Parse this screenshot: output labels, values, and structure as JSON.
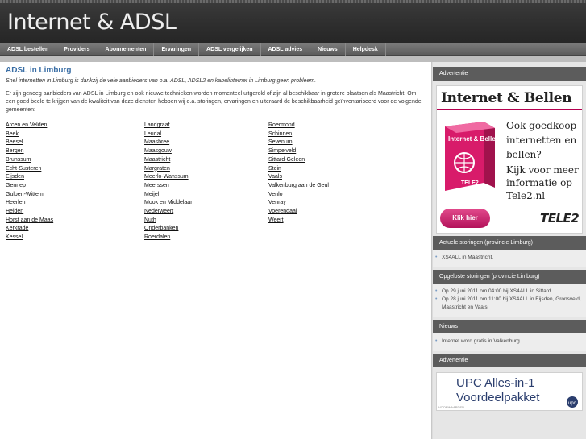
{
  "header": {
    "title": "Internet & ADSL"
  },
  "nav": {
    "items": [
      {
        "label": "ADSL bestellen"
      },
      {
        "label": "Providers"
      },
      {
        "label": "Abonnementen"
      },
      {
        "label": "Ervaringen"
      },
      {
        "label": "ADSL vergelijken"
      },
      {
        "label": "ADSL advies"
      },
      {
        "label": "Nieuws"
      },
      {
        "label": "Helpdesk"
      }
    ]
  },
  "main": {
    "title": "ADSL in Limburg",
    "intro": "Snel internetten in Limburg is dankzij de vele aanbieders van o.a. ADSL, ADSL2 en kabelinternet in Limburg geen probleem.",
    "body": "Er zijn genoeg aanbieders van ADSL in Limburg en ook nieuwe technieken worden momenteel uitgerold of zijn al beschikbaar in grotere plaatsen als Maastricht. Om een goed beeld te krijgen van de kwaliteit van deze diensten hebben wij o.a. storingen, ervaringen en uiteraard de beschikbaarheid geïnventariseerd voor de volgende gemeenten:",
    "col1": [
      "Arcen en Velden",
      "Beek",
      "Beesel",
      "Bergen",
      "Brunssum",
      "Echt-Susteren",
      "Eijsden",
      "Gennep",
      "Gulpen-Wittem",
      "Heerlen",
      "Helden",
      "Horst aan de Maas",
      "Kerkrade",
      "Kessel"
    ],
    "col2": [
      "Landgraaf",
      "Leudal",
      "Maasbree",
      "Maasgouw",
      "Maastricht",
      "Margraten",
      "Meerlo-Wanssum",
      "Meerssen",
      "Meijel",
      "Mook en Middelaar",
      "Nederweert",
      "Nuth",
      "Onderbanken",
      "Roerdalen"
    ],
    "col3": [
      "Roermond",
      "Schinnen",
      "Sevenum",
      "Simpelveld",
      "Sittard-Geleen",
      "Stein",
      "Vaals",
      "Valkenburg aan de Geul",
      "Venlo",
      "Venray",
      "Voerendaal",
      "Weert"
    ]
  },
  "sidebar": {
    "ad_heading": "Advertentie",
    "ad1": {
      "title": "Internet & Bellen",
      "box_text": "Internet & Bellen",
      "box_brand": "TELE2",
      "line1": "Ook goedkoop internetten en bellen?",
      "line2": "Kijk voor meer informatie op Tele2.nl",
      "button": "Klik hier",
      "brand": "TELE2"
    },
    "storingen_heading": "Actuele storingen (provincie Limburg)",
    "storingen_items": [
      {
        "prefix": "",
        "link": "XS4ALL",
        "suffix": " in Maastricht."
      }
    ],
    "opgelost_heading": "Opgeloste storingen (provincie Limburg)",
    "opgelost_items": [
      {
        "prefix": "Op 29 juni 2011 om 04:00 bij ",
        "link": "XS4ALL",
        "suffix": " in Sittard."
      },
      {
        "prefix": "Op 28 juni 2011 om 11:00 bij ",
        "link": "XS4ALL",
        "suffix": " in Eijsden, Gronsveld, Maastricht en Vaals."
      }
    ],
    "nieuws_heading": "Nieuws",
    "nieuws_items": [
      {
        "prefix": "",
        "link": "Internet",
        "suffix": " word gratis in Valkenburg"
      }
    ],
    "ad2_heading": "Advertentie",
    "ad2": {
      "line1": "UPC Alles-in-1",
      "line2": "Voordeelpakket",
      "tiny": "VOORWAARDEN",
      "logo": "upc"
    }
  },
  "colors": {
    "title_blue": "#3a6ea5",
    "header_dark": "#2e2e2e",
    "nav_grey": "#6a6a6a",
    "tele2_pink": "#c2185b",
    "upc_blue": "#2b3e6e"
  }
}
